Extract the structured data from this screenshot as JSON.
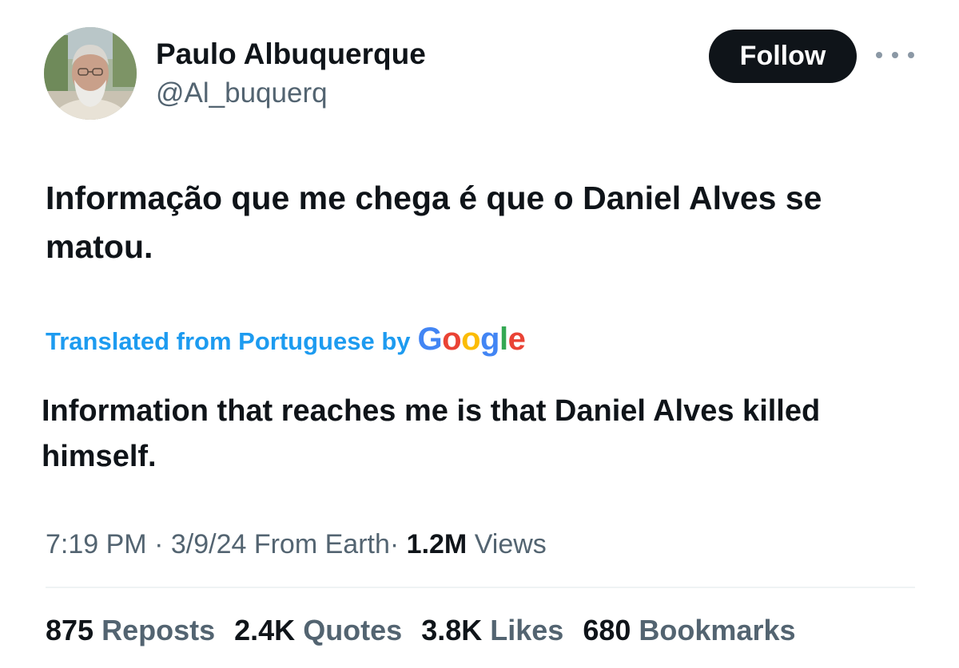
{
  "author": {
    "display_name": "Paulo Albuquerque",
    "handle": "@Al_buquerq"
  },
  "header": {
    "follow_label": "Follow",
    "more_icon": "more-horizontal-icon"
  },
  "tweet": {
    "text": "Informação que me chega é que o Daniel Alves se matou.",
    "translation_label": "Translated from Portuguese by",
    "translation_provider": "Google",
    "translated_text": "Information that reaches me is that Daniel Alves killed himself."
  },
  "meta": {
    "time": "7:19 PM",
    "separator": "·",
    "date": "3/9/24",
    "source": "From Earth",
    "views_count": "1.2M",
    "views_label": "Views"
  },
  "stats": [
    {
      "count": "875",
      "label": "Reposts"
    },
    {
      "count": "2.4K",
      "label": "Quotes"
    },
    {
      "count": "3.8K",
      "label": "Likes"
    },
    {
      "count": "680",
      "label": "Bookmarks"
    }
  ],
  "colors": {
    "text": "#0f1419",
    "secondary": "#536471",
    "accent": "#1d9bf0",
    "follow_bg": "#0f1419",
    "google_blue": "#4285F4",
    "google_red": "#EA4335",
    "google_yellow": "#FBBC05",
    "google_green": "#34A853"
  }
}
